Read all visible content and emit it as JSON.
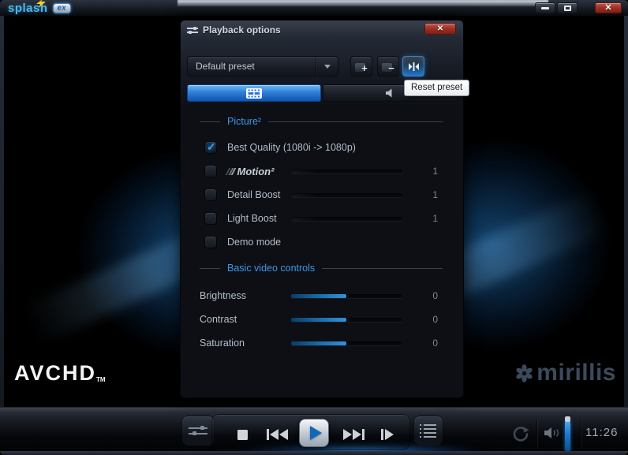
{
  "titlebar": {
    "logo_text": "splash",
    "logo_badge": "ex"
  },
  "glyphs": {
    "close": "✕",
    "add": "+",
    "remove": "−",
    "check": "✓"
  },
  "dialog": {
    "title": "Playback options",
    "preset_value": "Default preset",
    "tooltip": "Reset preset",
    "picture": {
      "title": "Picture²",
      "rows": [
        {
          "label": "Best Quality (1080i -> 1080p)",
          "checked": true
        },
        {
          "label": "Motion²",
          "checked": false,
          "value": "1",
          "fill_pct": 0
        },
        {
          "label": "Detail Boost",
          "checked": false,
          "value": "1",
          "fill_pct": 0
        },
        {
          "label": "Light Boost",
          "checked": false,
          "value": "1",
          "fill_pct": 0
        },
        {
          "label": "Demo mode",
          "checked": false
        }
      ]
    },
    "basic": {
      "title": "Basic video controls",
      "rows": [
        {
          "label": "Brightness",
          "value": "0",
          "fill_pct": 50
        },
        {
          "label": "Contrast",
          "value": "0",
          "fill_pct": 50
        },
        {
          "label": "Saturation",
          "value": "0",
          "fill_pct": 50
        }
      ]
    }
  },
  "video_overlay": {
    "avchd": "AVCHD",
    "avchd_tm": "TM",
    "mirillis": "mirillis"
  },
  "bottom_bar": {
    "time": "11:26"
  },
  "icons": {
    "options": "dual-sliders",
    "video_tab": "film-strip",
    "audio_tab": "speaker",
    "reset_preset": "triangles-to-center-bar",
    "dropdown_chevron": "chevron-down",
    "stop": "square",
    "previous": "bar-double-left-triangles",
    "play": "right-triangle",
    "next": "double-right-triangles-bar",
    "step_forward": "bar-right-triangle",
    "playlist": "dotted-list-lines",
    "repeat": "circular-arrow",
    "volume": "speaker-waves",
    "mirillis_flower": "six-petal-flower"
  },
  "colors": {
    "accent_blue": "#2f93dd",
    "tab_active_blue": "#2f7fd6",
    "close_red": "#a33226",
    "section_title_blue": "#3e97e6"
  }
}
